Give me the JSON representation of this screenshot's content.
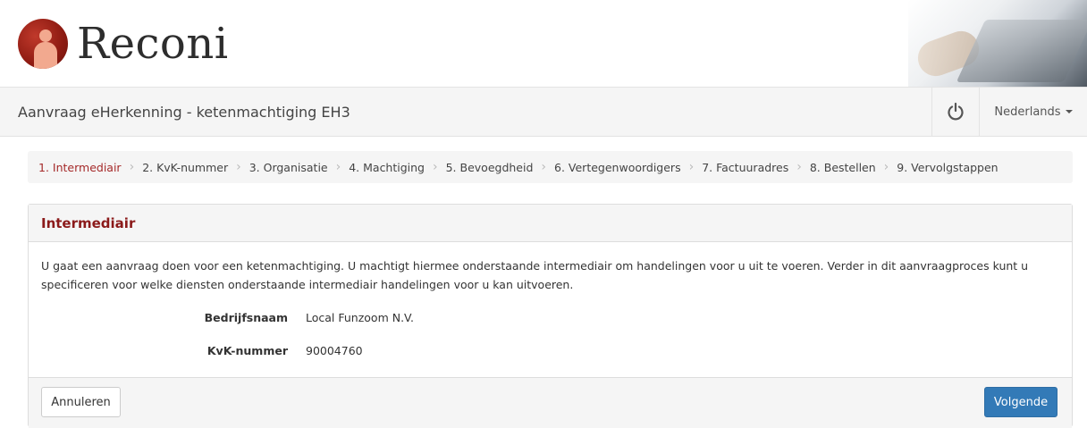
{
  "brand": {
    "name": "Reconi"
  },
  "header": {
    "title": "Aanvraag eHerkenning - ketenmachtiging EH3"
  },
  "language": {
    "selected": "Nederlands"
  },
  "steps": [
    "1. Intermediair",
    "2. KvK-nummer",
    "3. Organisatie",
    "4. Machtiging",
    "5. Bevoegdheid",
    "6. Vertegenwoordigers",
    "7. Factuuradres",
    "8. Bestellen",
    "9. Vervolgstappen"
  ],
  "active_step": 0,
  "panel": {
    "title": "Intermediair",
    "intro": "U gaat een aanvraag doen voor een ketenmachtiging. U machtigt hiermee onderstaande intermediair om handelingen voor u uit te voeren. Verder in dit aanvraagproces kunt u specificeren voor welke diensten onderstaande intermediair handelingen voor u kan uitvoeren.",
    "fields": [
      {
        "label": "Bedrijfsnaam",
        "value": "Local Funzoom N.V."
      },
      {
        "label": "KvK-nummer",
        "value": "90004760"
      }
    ]
  },
  "buttons": {
    "cancel": "Annuleren",
    "next": "Volgende"
  },
  "colors": {
    "accent": "#8b1a1a",
    "primary": "#337ab7",
    "active_step": "#a52a2a"
  },
  "icons": {
    "power": "power-icon",
    "separator": "chevron-right-icon",
    "dropdown": "caret-down-icon"
  }
}
